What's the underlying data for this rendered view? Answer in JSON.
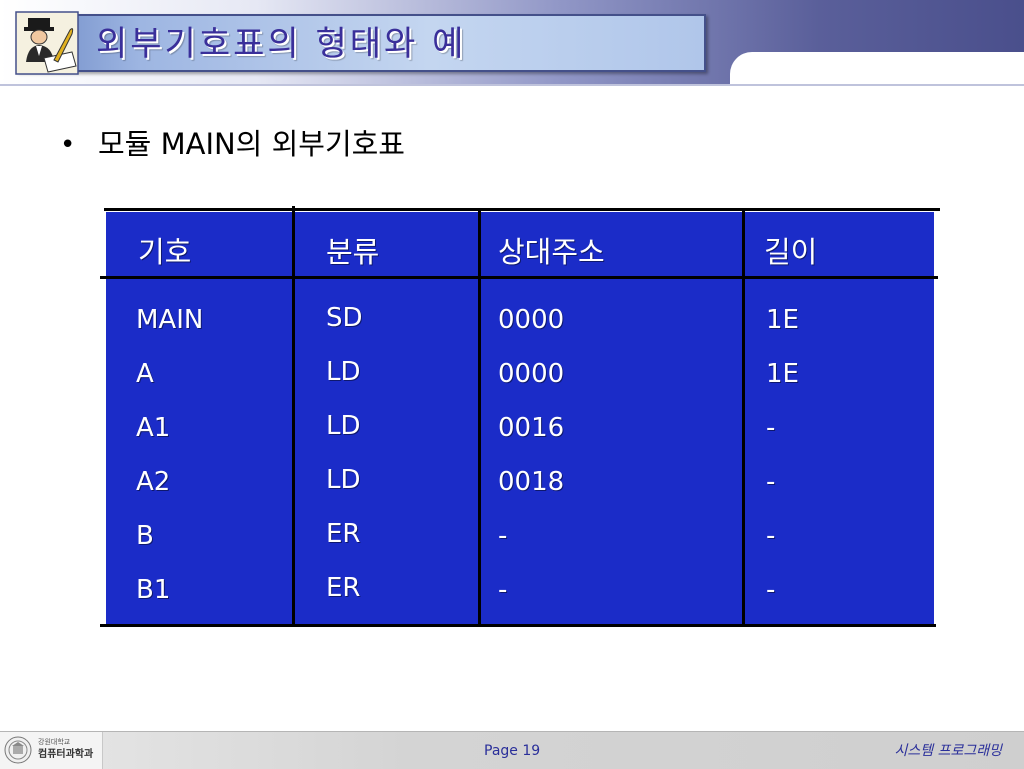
{
  "slide": {
    "title": "외부기호표의 형태와 예",
    "bullet": "모듈 MAIN의 외부기호표"
  },
  "table": {
    "headers": [
      "기호",
      "분류",
      "상대주소",
      "길이"
    ],
    "rows": [
      [
        "MAIN",
        "SD",
        "0000",
        "1E"
      ],
      [
        "A",
        "LD",
        "0000",
        "1E"
      ],
      [
        "A1",
        "LD",
        "0016",
        "-"
      ],
      [
        "A2",
        "LD",
        "0018",
        "-"
      ],
      [
        "B",
        "ER",
        "-",
        "-"
      ],
      [
        "B1",
        "ER",
        "-",
        "-"
      ]
    ]
  },
  "footer": {
    "university": "강원대학교",
    "department": "컴퓨터과학과",
    "page": "Page 19",
    "course": "시스템 프로그래밍"
  },
  "colors": {
    "title_text": "#3a2f9a",
    "table_background": "#1b2cc8",
    "table_text": "#ffffff",
    "footer_text": "#2a2f9a"
  },
  "icons": {
    "header_clipart": "writer-clipart-icon",
    "footer_logo": "university-seal-icon"
  }
}
